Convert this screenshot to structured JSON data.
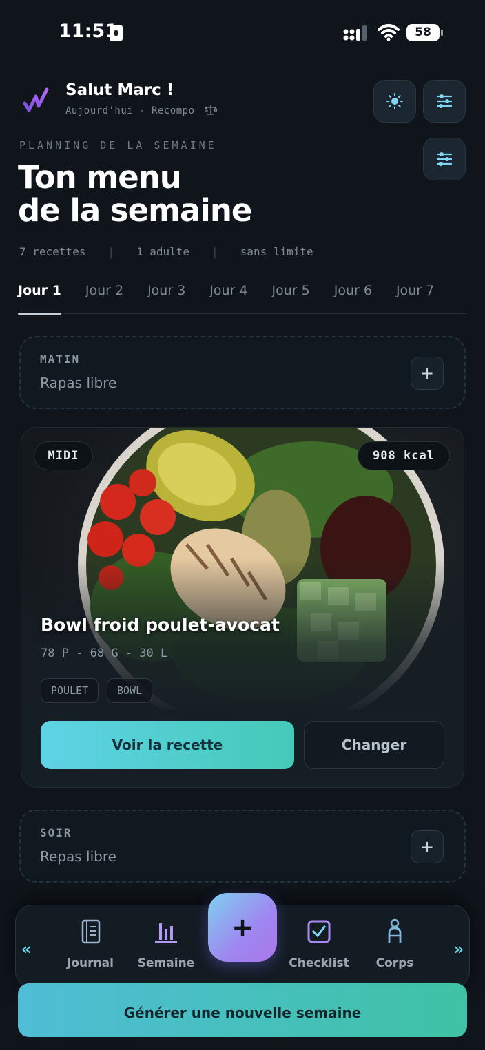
{
  "status_bar": {
    "time": "11:51",
    "battery": "58"
  },
  "header": {
    "greeting": "Salut Marc !",
    "subtitle": "Aujourd'hui - Recompo",
    "eyebrow": "PLANNING DE LA SEMAINE",
    "title_line1": "Ton menu",
    "title_line2": "de la semaine"
  },
  "meta": {
    "recipes": "7 recettes",
    "people": "1 adulte",
    "limit": "sans limite"
  },
  "tabs": [
    {
      "label": "Jour 1",
      "active": true
    },
    {
      "label": "Jour 2"
    },
    {
      "label": "Jour 3"
    },
    {
      "label": "Jour 4"
    },
    {
      "label": "Jour 5"
    },
    {
      "label": "Jour 6"
    },
    {
      "label": "Jour 7"
    }
  ],
  "slots": {
    "morning": {
      "label": "MATIN",
      "value": "Rapas libre",
      "add": "+"
    },
    "evening": {
      "label": "SOIR",
      "value": "Repas libre",
      "add": "+"
    }
  },
  "recipe": {
    "meal": "MIDI",
    "kcal": "908 kcal",
    "title": "Bowl froid poulet-avocat",
    "macros": "78 P - 68 G - 30 L",
    "tags": [
      "POULET",
      "BOWL"
    ],
    "primary_action": "Voir la recette",
    "secondary_action": "Changer"
  },
  "bottom_nav": {
    "items": [
      {
        "label": "Journal",
        "icon": "journal-icon"
      },
      {
        "label": "Semaine",
        "icon": "bar-chart-icon"
      },
      {
        "label": "Checklist",
        "icon": "checkbox-icon"
      },
      {
        "label": "Corps",
        "icon": "body-icon"
      }
    ],
    "fab": "+",
    "left_arrow": "«",
    "right_arrow": "»"
  },
  "generate_label": "Générer une nouvelle semaine",
  "colors": {
    "accent_teal": "#45c9b7",
    "accent_cyan": "#5fd3e6",
    "fab_purple": "#a978e8",
    "background": "#0f151b"
  }
}
